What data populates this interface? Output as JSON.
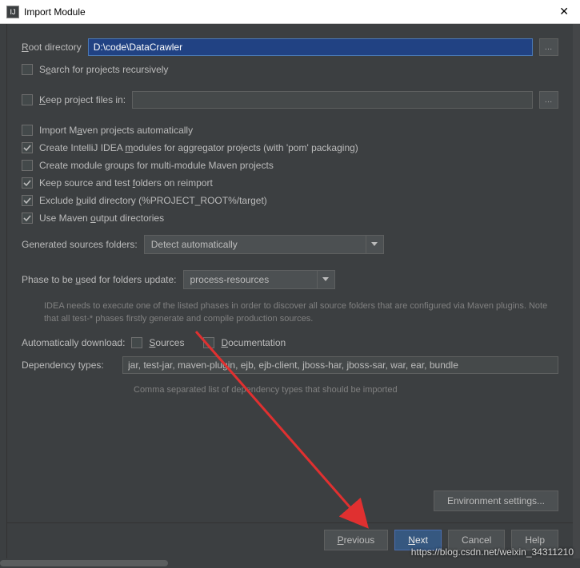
{
  "title": "Import Module",
  "rootdir": {
    "label": "Root directory",
    "value": "D:\\code\\DataCrawler"
  },
  "search_recursive": {
    "label_pre": "S",
    "label_u": "e",
    "label_post": "arch for projects recursively",
    "checked": false
  },
  "keep_files": {
    "label_pre": "",
    "label_u": "K",
    "label_post": "eep project files in:",
    "checked": false,
    "value": ""
  },
  "opts": [
    {
      "pre": "Import M",
      "u": "a",
      "post": "ven projects automatically",
      "checked": false
    },
    {
      "pre": "Create IntelliJ IDEA ",
      "u": "m",
      "post": "odules for aggregator projects (with 'pom' packaging)",
      "checked": true
    },
    {
      "pre": "Create module ",
      "u": "g",
      "post": "roups for multi-module Maven projects",
      "checked": false
    },
    {
      "pre": "Keep source and test ",
      "u": "f",
      "post": "olders on reimport",
      "checked": true
    },
    {
      "pre": "Exclude ",
      "u": "b",
      "post": "uild directory (%PROJECT_ROOT%/target)",
      "checked": true
    },
    {
      "pre": "Use Maven ",
      "u": "o",
      "post": "utput directories",
      "checked": true
    }
  ],
  "gen_src": {
    "label": "Generated sources folders:",
    "value": "Detect automatically"
  },
  "phase": {
    "label_pre": "Phase to be ",
    "label_u": "u",
    "label_post": "sed for folders update:",
    "value": "process-resources"
  },
  "phase_help": "IDEA needs to execute one of the listed phases in order to discover all source folders that are configured via Maven plugins. Note that all test-* phases firstly generate and compile production sources.",
  "autodl": {
    "label": "Automatically download:",
    "sources": {
      "pre": "",
      "u": "S",
      "post": "ources",
      "checked": false
    },
    "docs": {
      "pre": "",
      "u": "D",
      "post": "ocumentation",
      "checked": false
    }
  },
  "deptypes": {
    "label": "Dependency types:",
    "value": "jar, test-jar, maven-plugin, ejb, ejb-client, jboss-har, jboss-sar, war, ear, bundle"
  },
  "deptypes_help": "Comma separated list of dependency types that should be imported",
  "env_btn": "Environment settings...",
  "buttons": {
    "prev_u": "P",
    "prev_post": "revious",
    "next_u": "N",
    "next_post": "ext",
    "cancel": "Cancel",
    "help": "Help"
  },
  "watermark": "https://blog.csdn.net/weixin_34311210"
}
